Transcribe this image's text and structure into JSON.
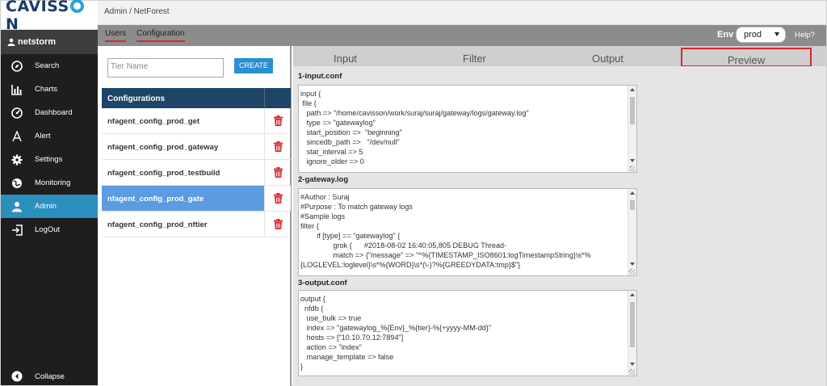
{
  "brand": {
    "name_pre": "CAVISS",
    "name_post": "N"
  },
  "user": {
    "name": "netstorm"
  },
  "sidebar": {
    "items": [
      {
        "label": "Search",
        "icon": "compass-icon"
      },
      {
        "label": "Charts",
        "icon": "bar-chart-icon"
      },
      {
        "label": "Dashboard",
        "icon": "gauge-icon"
      },
      {
        "label": "Alert",
        "icon": "letter-a-icon"
      },
      {
        "label": "Settings",
        "icon": "gear-icon"
      },
      {
        "label": "Monitoring",
        "icon": "globe-icon"
      },
      {
        "label": "Admin",
        "icon": "user-icon",
        "active": true
      },
      {
        "label": "LogOut",
        "icon": "logout-icon"
      }
    ],
    "collapse_label": "Collapse"
  },
  "header": {
    "breadcrumb": "Admin / NetForest"
  },
  "subnav": {
    "tabs": [
      "Users",
      "Configuration"
    ],
    "env_label": "Env",
    "env_value": "prod",
    "help_label": "Help?"
  },
  "config": {
    "tier_placeholder": "Tier Name",
    "create_label": "CREATE",
    "table_header": "Configurations",
    "rows": [
      "nfagent_config_prod_get",
      "nfagent_config_prod_gateway",
      "nfagent_config_prod_testbuild",
      "nfagent_config_prod_gate",
      "nfagent_config_prod_nftier"
    ],
    "selected_index": 3
  },
  "pipeline": {
    "tabs": [
      "Input",
      "Filter",
      "Output",
      "Preview"
    ],
    "active_tab": "Preview",
    "sections": [
      {
        "title": "1-input.conf",
        "lines": [
          "input {",
          " file {",
          "   path => \"/home/cavisson/work/suraj/suraj/gateway/logs/gateway.log\"",
          "   type => \"gatewaylog\"",
          "   start_position =>  \"beginning\"",
          "   sincedb_path =>   \"/dev/null\"",
          "   stat_interval => 5",
          "   ignore_older => 0"
        ]
      },
      {
        "title": "2-gateway.log",
        "lines": [
          "#Author : Suraj",
          "#Purpose : To match gateway logs",
          "#Sample logs",
          "filter {",
          "        if [type] == \"gatewaylog\" {",
          "                grok {      #2018-08-02 16:40:05,805 DEBUG Thread-",
          "                match => {\"message\" => \"^%{TIMESTAMP_ISO8601:logTimestampString}\\s*%",
          "{LOGLEVEL:loglevel}\\s*%{WORD}\\s*(\\-)?%{GREEDYDATA:tmp}$\"}"
        ]
      },
      {
        "title": "3-output.conf",
        "lines": [
          "output {",
          "  nfdb {",
          "   use_bulk => true",
          "   index => \"gatewaylog_%{Env}_%{tier}-%{+yyyy-MM-dd}\"",
          "   hosts => [\"10.10.70.12:7894\"]",
          "   action => \"index\"",
          "   manage_template => false",
          "}"
        ]
      }
    ]
  },
  "colors": {
    "sidebar_bg": "#1e1e1e",
    "active_nav": "#2a8fbd",
    "accent_red": "#d9262b",
    "create_button": "#2a8fd0",
    "selected_row": "#5b9bdf",
    "table_header": "#1e4468",
    "trash": "#d9262b"
  }
}
